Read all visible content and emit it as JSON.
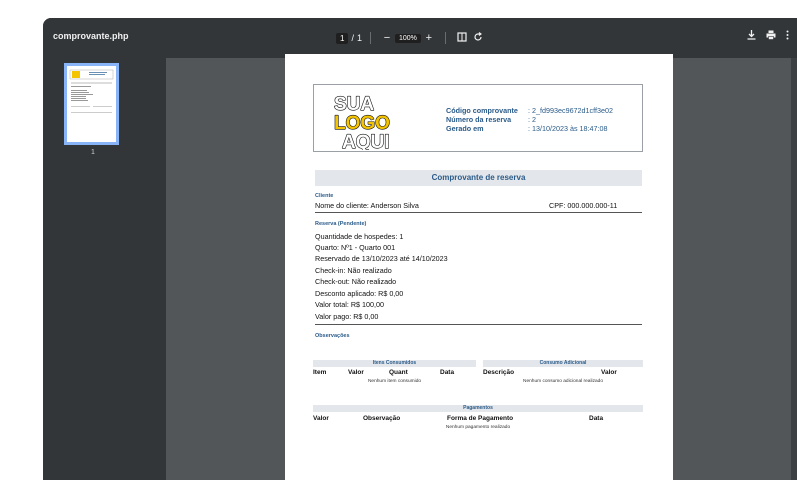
{
  "viewer": {
    "filename": "comprovante.php",
    "page_current": "1",
    "page_sep": "/",
    "page_total": "1",
    "zoom_level": "100%",
    "thumbnail_page": "1"
  },
  "header": {
    "logo_lines": [
      "SUA",
      "LOGO",
      "AQUI"
    ],
    "codigo_label": "Código comprovante",
    "codigo_value": ": 2_fd993ec9672d1cff3e02",
    "reserva_label": "Número da reserva",
    "reserva_value": ": 2",
    "gerado_label": "Gerado em",
    "gerado_value": ": 13/10/2023 às 18:47:08"
  },
  "doc": {
    "title": "Comprovante de reserva",
    "cliente_section": "Cliente",
    "cliente_nome": "Nome do cliente: Anderson Silva",
    "cliente_cpf": "CPF: 000.000.000-11",
    "reserva_section": "Reserva (Pendente)",
    "reserva_lines": [
      "Quantidade de hospedes: 1",
      "Quarto: Nº1 - Quarto 001",
      "Reservado de 13/10/2023 até 14/10/2023",
      "Check-in: Não realizado",
      "Check-out: Não realizado",
      "Desconto aplicado: R$ 0,00",
      "Valor total: R$ 100,00",
      "Valor pago: R$ 0,00"
    ],
    "obs_section": "Observações",
    "itens": {
      "title": "Itens Consumidos",
      "headers": [
        "Item",
        "Valor",
        "Quant",
        "Data"
      ],
      "empty": "Nenhum item consumido"
    },
    "adicional": {
      "title": "Consumo Adicional",
      "headers": [
        "Descrição",
        "Valor"
      ],
      "empty": "Nenhum consumo adicional realizado"
    },
    "pagamentos": {
      "title": "Pagamentos",
      "headers": [
        "Valor",
        "Observação",
        "Forma de Pagamento",
        "Data"
      ],
      "empty": "Nenhum pagamento realizado"
    }
  },
  "colors": {
    "toolbar": "#323639",
    "viewer_bg": "#525659",
    "accent_blue": "#2a5b8a",
    "logo_yellow": "#f5c400"
  }
}
